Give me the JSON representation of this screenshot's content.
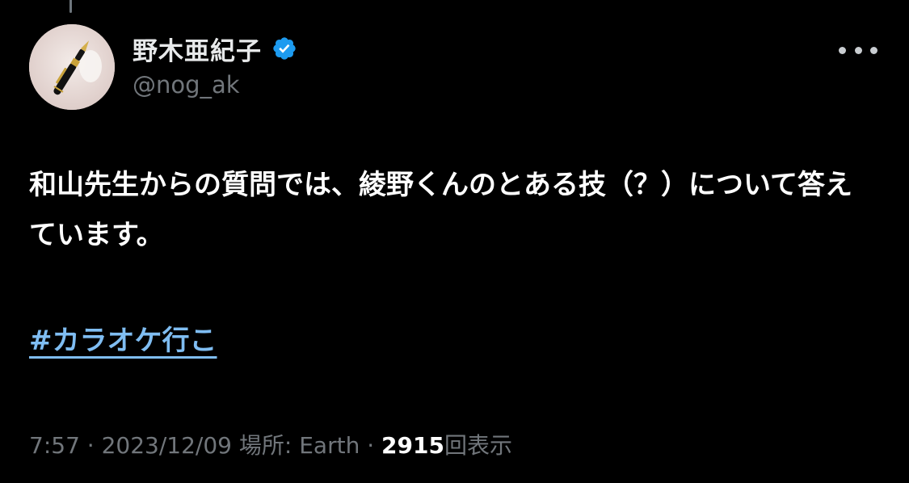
{
  "author": {
    "display_name": "野木亜紀子",
    "handle": "@nog_ak",
    "verified": true,
    "avatar_icon": "fountain-pen-icon"
  },
  "tweet": {
    "text": "和山先生からの質問では、綾野くんのとある技（？）について答えています。",
    "hashtag": "#カラオケ行こ"
  },
  "meta": {
    "time": "7:57",
    "separator": "·",
    "date": "2023/12/09",
    "location": "場所: Earth",
    "views_count": "2915",
    "views_label": "回表示"
  },
  "colors": {
    "background": "#000000",
    "text": "#ffffff",
    "muted": "#71767b",
    "link": "#7fbdf2",
    "verified": "#1d9bf0"
  }
}
